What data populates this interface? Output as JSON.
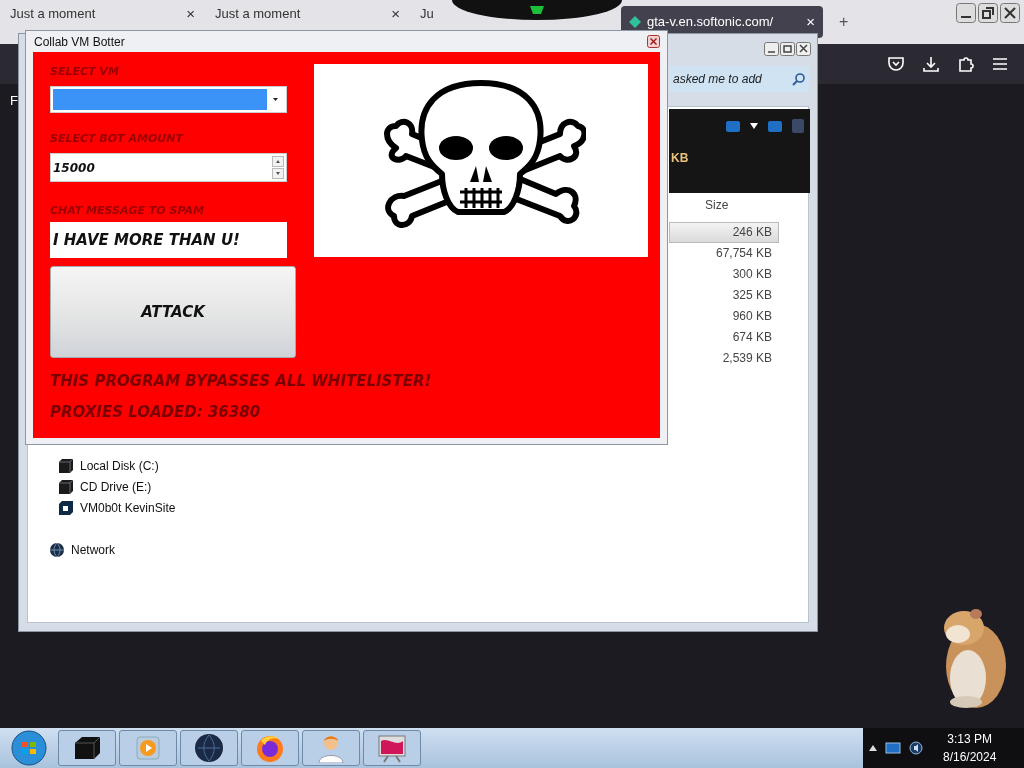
{
  "browser": {
    "tabs": [
      {
        "title": "Just a moment",
        "selected": false
      },
      {
        "title": "Just a moment",
        "selected": false
      },
      {
        "title": "Ju",
        "selected": false,
        "close_hidden": true
      },
      {
        "title": "gta-v.en.softonic.com/",
        "selected": true
      }
    ],
    "close_glyph": "×",
    "new_tab_glyph": "+",
    "side_text": "F"
  },
  "explorer": {
    "search_text": "asked me to add",
    "toolbar_text": "KB",
    "size_header": "Size",
    "sizes": [
      {
        "text": "246 KB",
        "selected": true
      },
      {
        "text": "67,754 KB",
        "selected": false
      },
      {
        "text": "300 KB",
        "selected": false
      },
      {
        "text": "325 KB",
        "selected": false
      },
      {
        "text": "960 KB",
        "selected": false
      },
      {
        "text": "674 KB",
        "selected": false
      },
      {
        "text": "2,539 KB",
        "selected": false
      }
    ],
    "nav": [
      {
        "label": "Local Disk (C:)",
        "kind": "disk"
      },
      {
        "label": "CD Drive (E:)",
        "kind": "disk"
      },
      {
        "label": "VM0b0t KevinSite",
        "kind": "share"
      },
      {
        "label": "Network",
        "kind": "network"
      }
    ]
  },
  "app": {
    "title": "Collab VM Botter",
    "vm_label": "SELECT VM",
    "bot_label": "SELECT BOT AMOUNT",
    "bot_amount": "15000",
    "chat_label": "CHAT MESSAGE TO SPAM",
    "chat_message": "I HAVE MORE THAN U!",
    "attack": "ATTACK",
    "notes": [
      "THIS PROGRAM BYPASSES ALL WHITELISTER!",
      "PROXIES LOADED: 36380"
    ]
  },
  "taskbar": {
    "apps": [
      {
        "kind": "drive"
      },
      {
        "kind": "media"
      },
      {
        "kind": "globe"
      },
      {
        "kind": "firefox"
      },
      {
        "kind": "person"
      },
      {
        "kind": "display"
      }
    ],
    "time": "3:13 PM",
    "date": "8/16/2024"
  }
}
